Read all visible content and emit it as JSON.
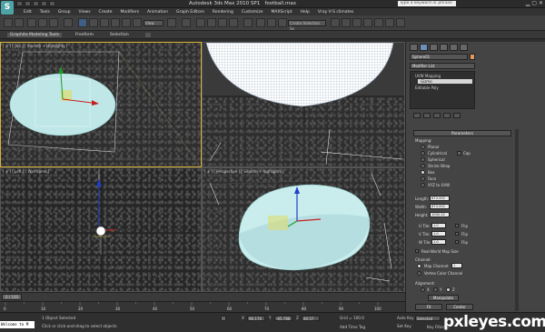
{
  "app": {
    "logo_letter": "S",
    "title": "Autodesk 3ds Max 2010 SP1",
    "file_name": "football.max",
    "search_placeholder": "Type a keyword or phrase"
  },
  "menu": [
    "Edit",
    "Tools",
    "Group",
    "Views",
    "Create",
    "Modifiers",
    "Animation",
    "Graph Editors",
    "Rendering",
    "Customize",
    "MAXScript",
    "Help",
    "Vray V-S climates"
  ],
  "toolbar": {
    "view_dropdown": "View",
    "selection_set": "Create Selection Se"
  },
  "ribbon": {
    "tabs": [
      "Graphite Modeling Tools",
      "Freeform",
      "Selection"
    ],
    "active": "Graphite Modeling Tools"
  },
  "viewports": {
    "top": "[ + ] [ Top ] [ Smooth + Highlights ]",
    "front": "",
    "left": "[ + ] [ Left ] [ Wireframe ]",
    "perspective": "[ + ] [ Perspective ] [ Smooth + Highlights ]"
  },
  "command_panel": {
    "object_name": "Sphere01",
    "modifier_list": "Modifier List",
    "stack": [
      "UVW Mapping",
      "Gizmo",
      "Editable Poly"
    ],
    "rollout_title": "Parameters",
    "mapping_label": "Mapping:",
    "mapping_options": [
      "Planar",
      "Cylindrical",
      "Spherical",
      "Shrink Wrap",
      "Box",
      "Face",
      "XYZ to UVW"
    ],
    "cap_label": "Cap",
    "selected_mapping": "Box",
    "length_label": "Length:",
    "length_value": "673.332",
    "width_label": "Width:",
    "width_value": "673.332",
    "height_label": "Height:",
    "height_value": "1000.32",
    "utile_label": "U Tile:",
    "utile_value": "1.0",
    "vtile_label": "V Tile:",
    "vtile_value": "1.0",
    "wtile_label": "W Tile:",
    "wtile_value": "1.0",
    "flip_label": "Flip",
    "real_world": "Real-World Map Size",
    "channel_label": "Channel:",
    "map_channel_label": "Map Channel:",
    "map_channel_value": "1",
    "vertex_color": "Vertex Color Channel",
    "alignment_label": "Alignment:",
    "align_axes": [
      "X",
      "Y",
      "Z"
    ],
    "manipulate": "Manipulate",
    "fit_button": "Fit",
    "center_button": "Center"
  },
  "timeline": {
    "frame_display": "0 / 100",
    "ticks": [
      "0",
      "10",
      "20",
      "30",
      "40",
      "50",
      "60",
      "70",
      "80",
      "90",
      "100"
    ]
  },
  "status": {
    "maxscript": "Welcome to M",
    "selection": "1 Object Selected",
    "prompt": "Click or click-and-drag to select objects",
    "x_value": "96.176",
    "y_value": "-65.788",
    "z_value": "40.57",
    "grid": "Grid = 100.0",
    "add_time_tag": "Add Time Tag",
    "auto_key": "Auto Key",
    "set_key": "Set Key",
    "selected": "Selected",
    "key_filters": "Key Filters..."
  },
  "watermark": "pxleyes.com"
}
